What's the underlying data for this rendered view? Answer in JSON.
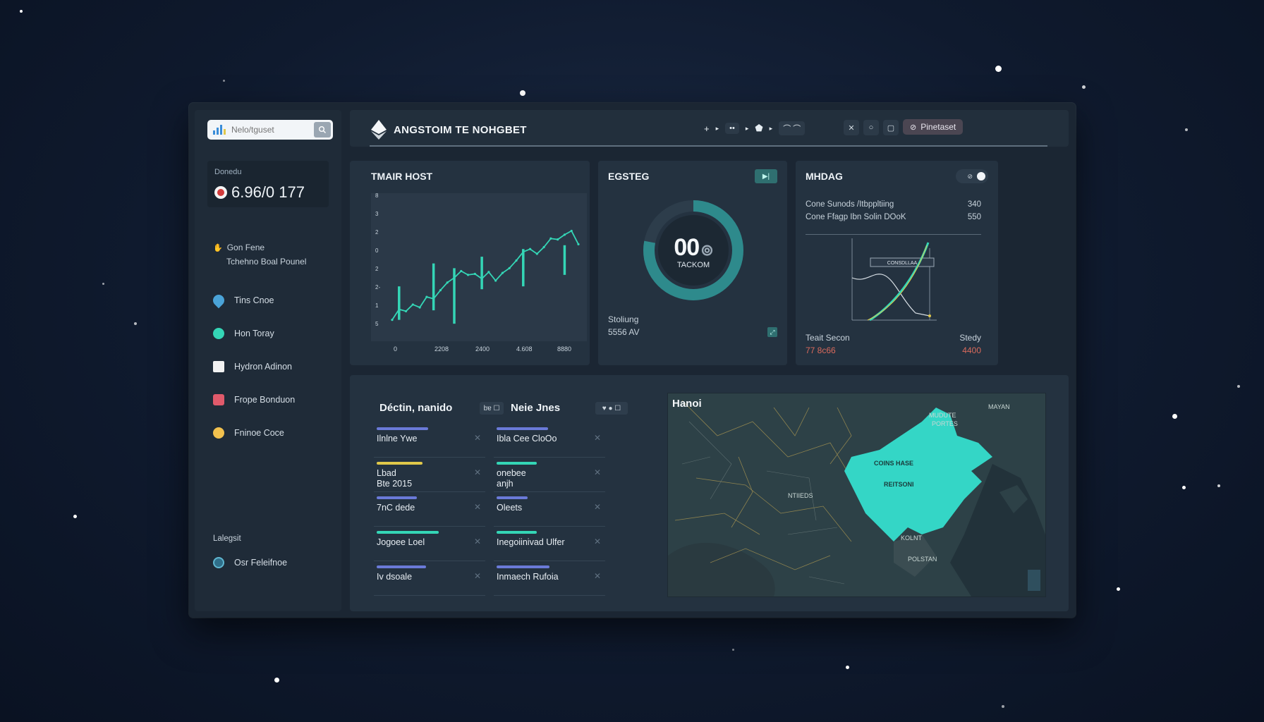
{
  "search": {
    "placeholder": "Nelo/tguset"
  },
  "balance": {
    "label": "Donedu",
    "value": "6.96/0 177"
  },
  "sidebar": {
    "section_title": "Gon Fene",
    "section_sub": "Tchehno Boal Pounel",
    "items": [
      {
        "label": "Tins Cnoe",
        "color": "#4aa3d8"
      },
      {
        "label": "Hon Toray",
        "color": "#34d6b6"
      },
      {
        "label": "Hydron Adinon",
        "color": "#f2f2f2"
      },
      {
        "label": "Frope Bonduon",
        "color": "#e05a6b"
      },
      {
        "label": "Fninoe Coce",
        "color": "#f2c14e"
      }
    ],
    "footer_label": "Lalegsit",
    "footer_item": "Osr Feleifnoe"
  },
  "header": {
    "brand": "ANGSTOIM TE NOHGBET",
    "crumbs": [
      "+",
      "▸",
      "••",
      "▸",
      "⬟",
      "▸",
      "⌒ ⌒"
    ],
    "primary_button": "Pinetaset"
  },
  "card1": {
    "title": "TMAIR HOST"
  },
  "card2": {
    "title": "EGSTEG",
    "gauge_value": "00",
    "gauge_label": "TACKOM",
    "gauge_fraction": 0.78,
    "footer_line1": "Stoliung",
    "footer_line2": "5556 AV"
  },
  "card3": {
    "title": "MHDAG",
    "rows": [
      {
        "label": "Cone Sunods /Itbppltiing",
        "value": "340"
      },
      {
        "label": "Cone Ffagp Ibn Solin DOoK",
        "value": "550"
      }
    ],
    "chart_tag": "CONSDLLAA",
    "foot_left": "Teait Secon",
    "foot_right": "Stedy",
    "foot_left_value": "77 8c66",
    "foot_right_value": "4400"
  },
  "lists": {
    "left_title": "Déctin, nanido",
    "left_chip": "bɐ ☐",
    "right_title": "Neie Jnes",
    "right_chip": "♥ ● ☐",
    "left_rows": [
      {
        "label": "Ilnlne Ywe",
        "bar_color": "#6a7ad8",
        "bar_fraction": 0.56
      },
      {
        "label": "Lbad\nBte 2015",
        "bar_color": "#e0c84a",
        "bar_fraction": 0.5
      },
      {
        "label": "7nC dede",
        "bar_color": "#6a7ad8",
        "bar_fraction": 0.44
      },
      {
        "label": "Jogoee Loel",
        "bar_color": "#34d6b6",
        "bar_fraction": 0.68
      },
      {
        "label": "Iv dsoale",
        "bar_color": "#6a7ad8",
        "bar_fraction": 0.54
      }
    ],
    "right_rows": [
      {
        "label": "Ibla Cee CloOo",
        "bar_color": "#6a7ad8",
        "bar_fraction": 0.56
      },
      {
        "label": "onebee\nanjh",
        "bar_color": "#34d6b6",
        "bar_fraction": 0.44
      },
      {
        "label": "Oleets",
        "bar_color": "#6a7ad8",
        "bar_fraction": 0.34
      },
      {
        "label": "Inegoiinivad Ulfer",
        "bar_color": "#34d6b6",
        "bar_fraction": 0.44
      },
      {
        "label": "Inmaech Rufoia",
        "bar_color": "#6a7ad8",
        "bar_fraction": 0.58
      }
    ]
  },
  "map": {
    "title": "Hanoi",
    "labels": [
      "MUDUTE",
      "PORTES",
      "MAYAN",
      "COINS HASE",
      "REITSONI",
      "NTIIEDS",
      "KOLNT",
      "POLSTAN"
    ]
  },
  "colors": {
    "accent": "#34d6b6",
    "panel": "#243240",
    "background": "#0f1a2e"
  },
  "chart_data": [
    {
      "type": "line",
      "title": "TMAIR HOST",
      "x": [
        "0",
        "2208",
        "2400",
        "4.608",
        "8880"
      ],
      "xlabel": "",
      "ylabel": "",
      "ylim": [
        -6,
        8
      ],
      "yticks": [
        "8",
        "3",
        "2",
        "0",
        "2",
        "2-",
        "1",
        "5"
      ],
      "series": [
        {
          "values": [
            -4.5,
            -3.4,
            -3.6,
            -2.9,
            -3.2,
            -2.1,
            -2.3,
            -1.4,
            -0.6,
            -0.1,
            0.6,
            0.2,
            0.3,
            -0.2,
            0.5,
            -0.4,
            0.4,
            0.9,
            1.7,
            2.6,
            2.9,
            2.4,
            3.1,
            4.0,
            3.9,
            4.4,
            4.8,
            3.4
          ]
        }
      ],
      "spikes": [
        {
          "index": 1,
          "low": -4.5,
          "high": -1.0
        },
        {
          "index": 6,
          "low": -3.5,
          "high": 1.4
        },
        {
          "index": 9,
          "low": -4.9,
          "high": 0.9
        },
        {
          "index": 13,
          "low": -1.3,
          "high": 2.1
        },
        {
          "index": 19,
          "low": -1.0,
          "high": 2.9
        },
        {
          "index": 25,
          "low": 0.2,
          "high": 3.3
        }
      ]
    }
  ]
}
